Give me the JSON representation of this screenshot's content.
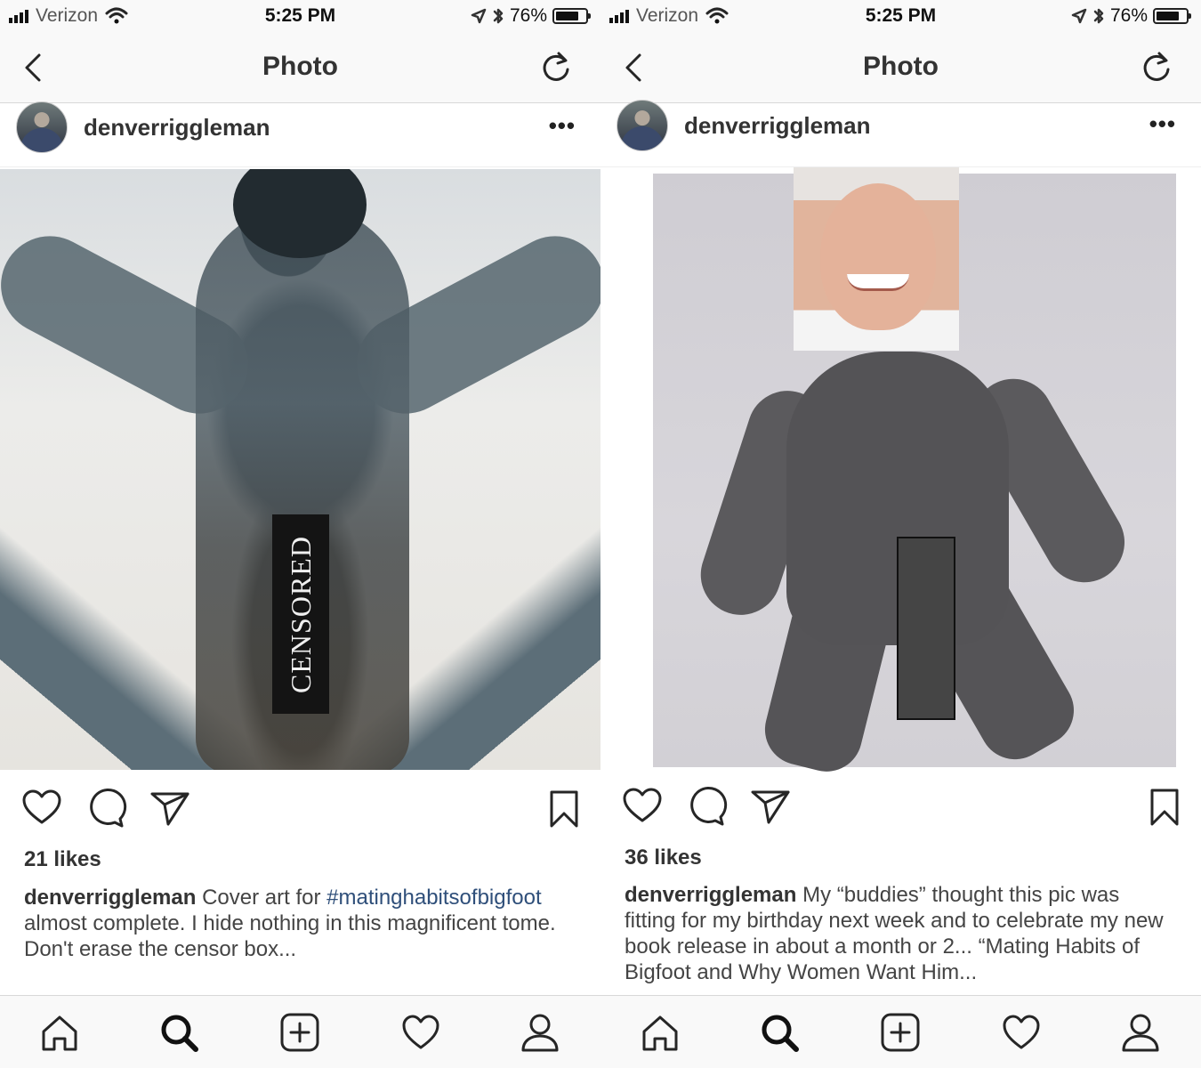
{
  "screens": [
    {
      "status": {
        "carrier": "Verizon",
        "time": "5:25 PM",
        "battery": "76%"
      },
      "nav": {
        "title": "Photo"
      },
      "post": {
        "username": "denverriggleman",
        "more": "•••",
        "censor_text": "CENSORED",
        "likes": "21 likes",
        "caption_user": "denverriggleman",
        "caption_text_1": " Cover art for ",
        "hashtag": "#matinghabitsofbigfoot",
        "caption_text_2": " almost complete.  I hide nothing in this magnificent tome. Don't erase the censor box..."
      }
    },
    {
      "status": {
        "carrier": "Verizon",
        "time": "5:25 PM",
        "battery": "76%"
      },
      "nav": {
        "title": "Photo"
      },
      "post": {
        "username": "denverriggleman",
        "more": "•••",
        "likes": "36 likes",
        "caption_user": "denverriggleman",
        "caption_text": " My “buddies” thought this pic was fitting for my birthday next week and to celebrate my new book release in about a month or 2... “Mating Habits of Bigfoot and Why Women Want Him..."
      }
    }
  ],
  "icons": {
    "back": "chevron-left-icon",
    "refresh": "refresh-icon",
    "like": "heart-icon",
    "comment": "comment-icon",
    "share": "send-icon",
    "save": "bookmark-icon",
    "tabs": [
      "home-icon",
      "search-icon",
      "add-icon",
      "activity-heart-icon",
      "profile-icon"
    ]
  },
  "colors": {
    "hashtag": "#2f4f7a",
    "bars": "#f9f9f9",
    "censor": "#141414"
  }
}
